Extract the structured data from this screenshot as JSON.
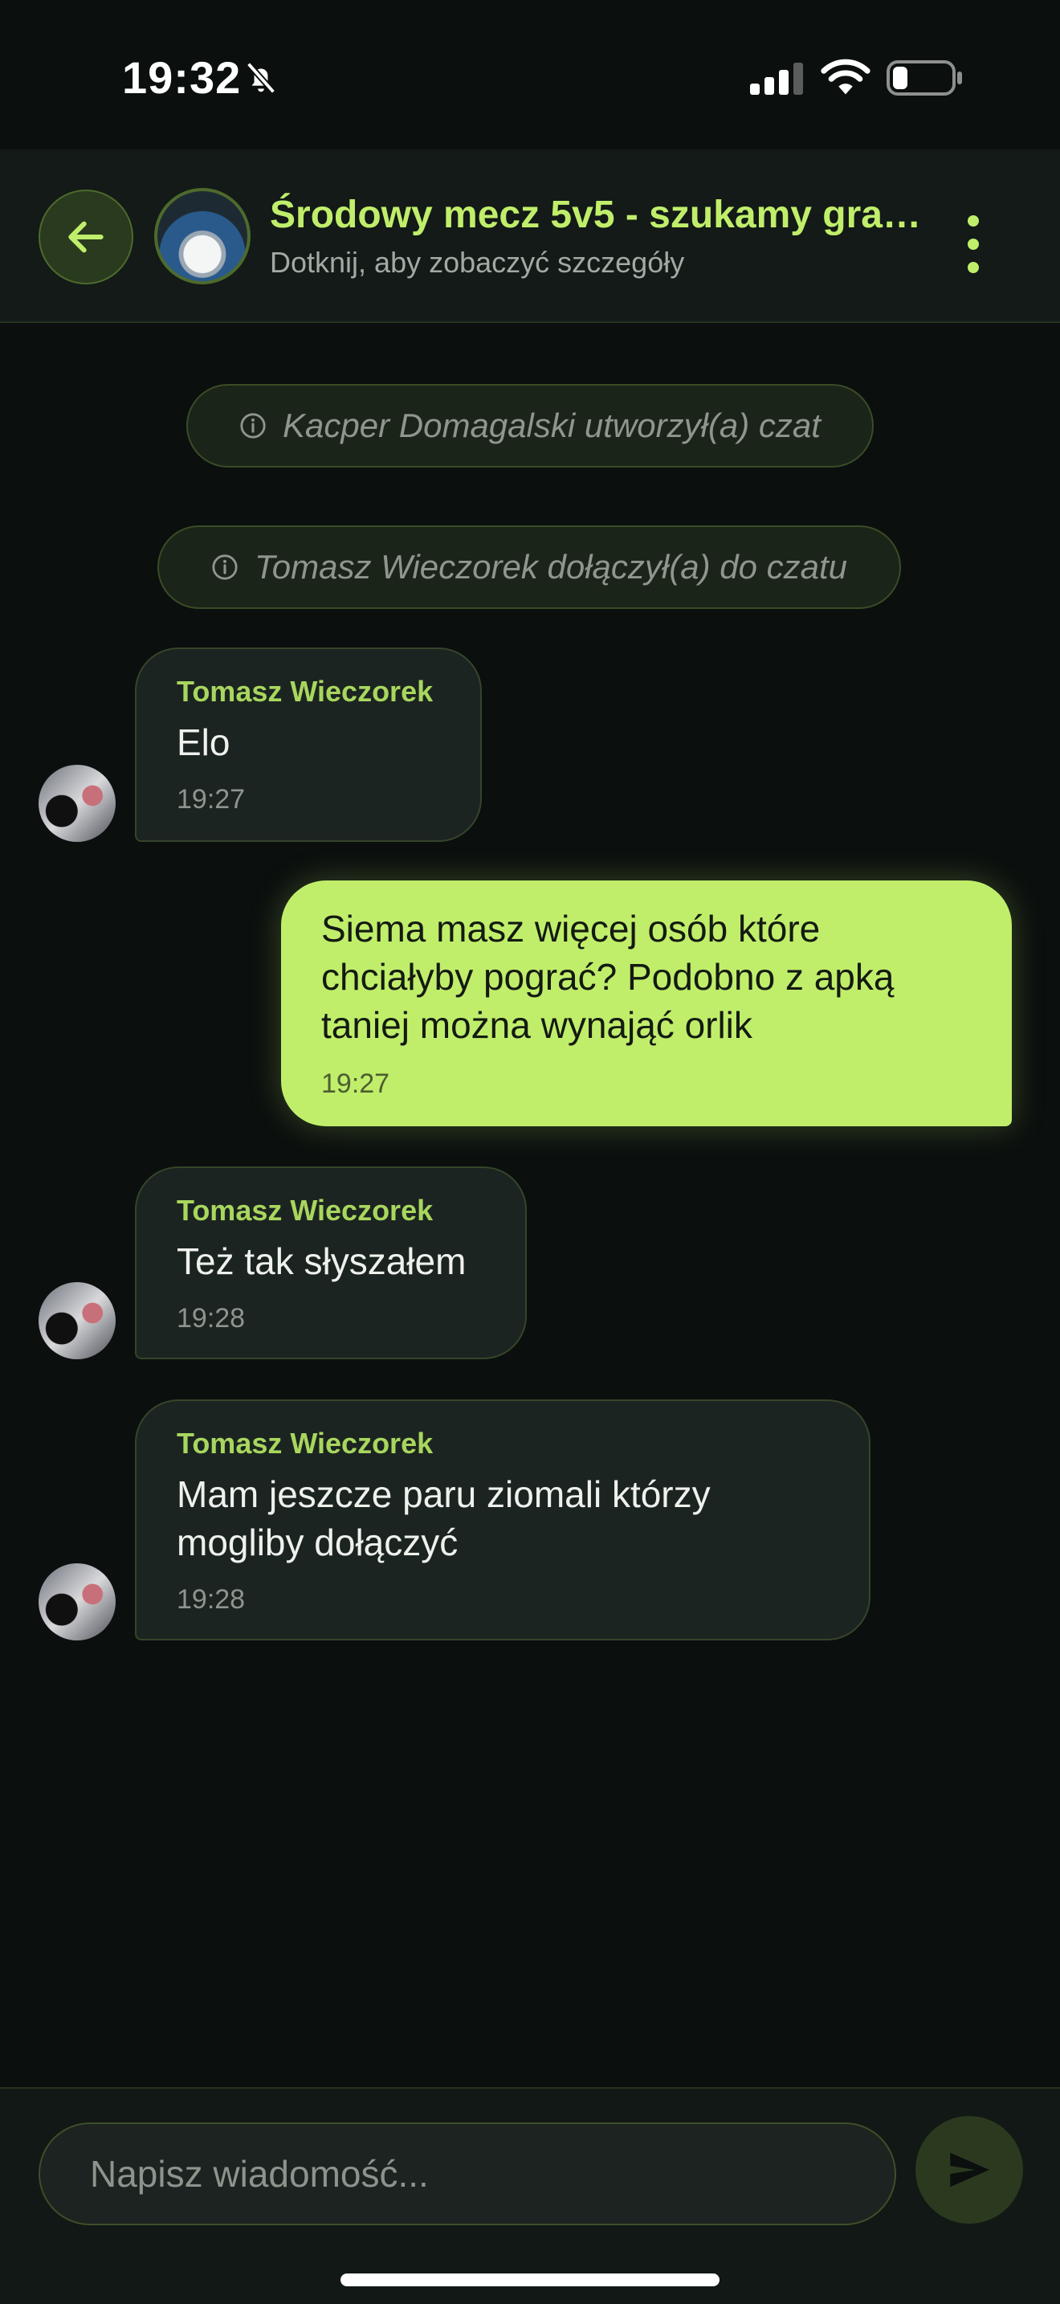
{
  "status_bar": {
    "time": "19:32",
    "icons": [
      "bell-off-icon",
      "cellular-signal-icon",
      "wifi-icon",
      "battery-icon"
    ]
  },
  "header": {
    "back_icon": "arrow-left-icon",
    "title": "Środowy mecz 5v5 - szukamy graczy",
    "subtitle": "Dotknij, aby zobaczyć szczegóły",
    "menu_icon": "more-vertical-icon"
  },
  "system_messages": [
    {
      "text": "Kacper Domagalski utworzył(a) czat",
      "icon": "info-icon"
    },
    {
      "text": "Tomasz Wieczorek dołączył(a) do czatu",
      "icon": "info-icon"
    }
  ],
  "messages": [
    {
      "direction": "incoming",
      "sender": "Tomasz Wieczorek",
      "text": "Elo",
      "time": "19:27"
    },
    {
      "direction": "outgoing",
      "text": "Siema masz więcej osób które chciałyby pograć? Podobno z apką taniej można wynająć orlik",
      "time": "19:27"
    },
    {
      "direction": "incoming",
      "sender": "Tomasz Wieczorek",
      "text": "Też tak słyszałem",
      "time": "19:28"
    },
    {
      "direction": "incoming",
      "sender": "Tomasz Wieczorek",
      "text": "Mam jeszcze paru ziomali którzy mogliby dołączyć",
      "time": "19:28"
    }
  ],
  "composer": {
    "placeholder": "Napisz wiadomość...",
    "value": "",
    "send_icon": "send-icon"
  },
  "colors": {
    "background": "#0b0f0e",
    "accent": "#c0ee6b",
    "incoming_bubble": "#1c2421",
    "sender_name": "#a8d65e"
  }
}
